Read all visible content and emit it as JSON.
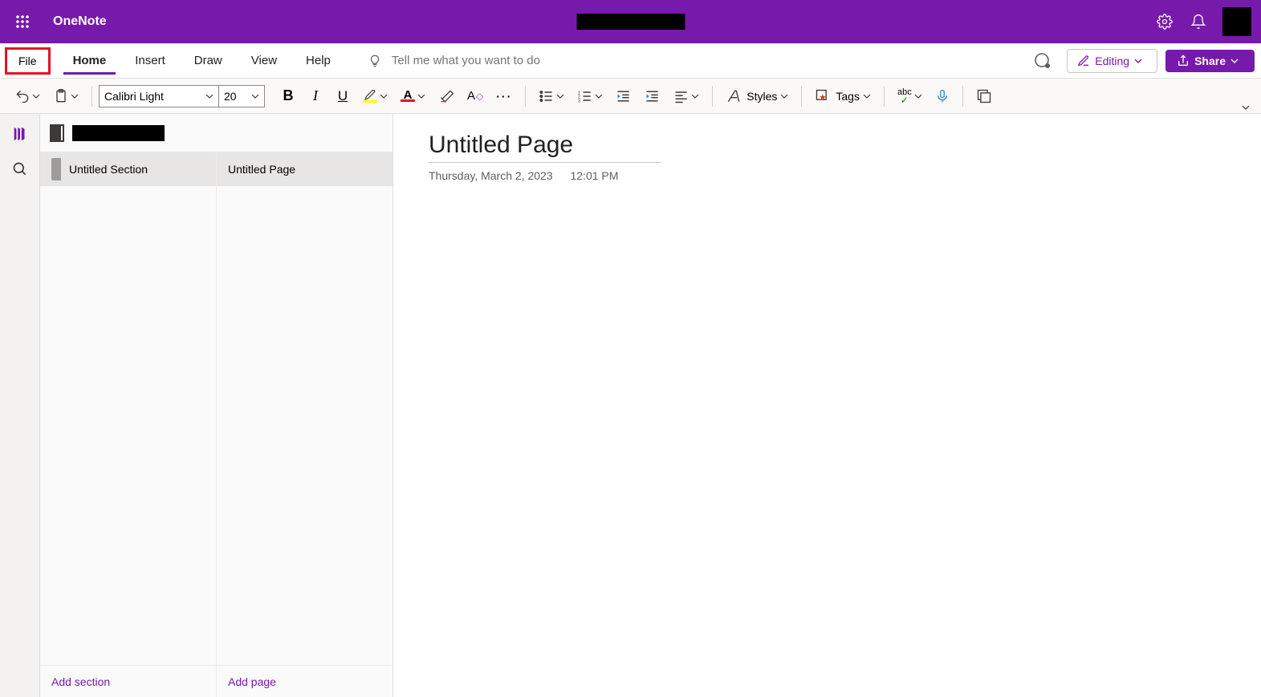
{
  "app": {
    "name": "OneNote"
  },
  "menu": {
    "file_highlighted": "File",
    "tabs": [
      "Home",
      "Insert",
      "Draw",
      "View",
      "Help"
    ],
    "active_tab_index": 0,
    "tell_me_placeholder": "Tell me what you want to do",
    "editing_label": "Editing",
    "share_label": "Share"
  },
  "ribbon": {
    "font_name": "Calibri Light",
    "font_size": "20",
    "styles_label": "Styles",
    "tags_label": "Tags"
  },
  "nav": {
    "section": "Untitled Section",
    "page": "Untitled Page",
    "add_section": "Add section",
    "add_page": "Add page"
  },
  "page": {
    "title": "Untitled Page",
    "date": "Thursday, March 2, 2023",
    "time": "12:01 PM"
  }
}
